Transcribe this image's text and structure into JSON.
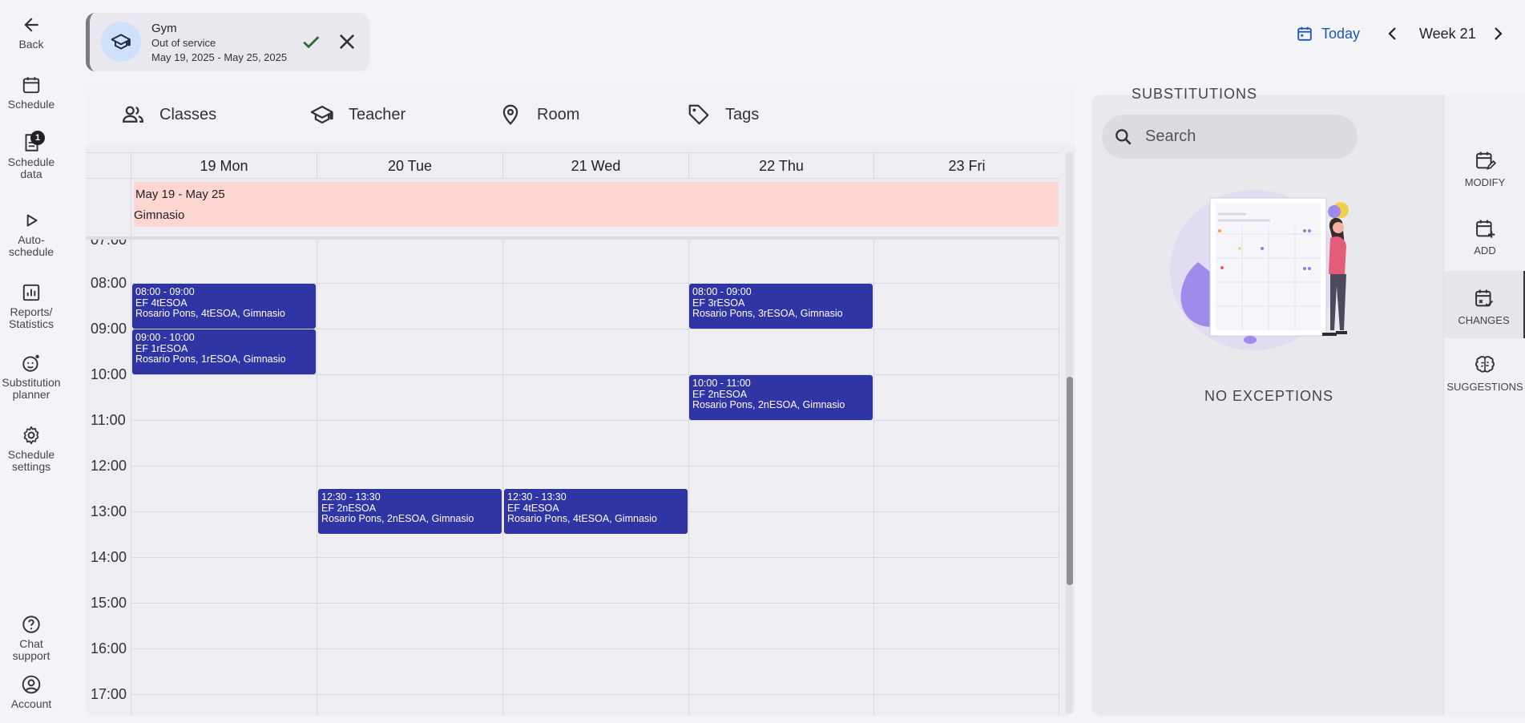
{
  "nav": {
    "back": "Back",
    "schedule": "Schedule",
    "schedule_data": "Schedule\ndata",
    "schedule_data_badge": "1",
    "auto_schedule": "Auto-\nschedule",
    "reports": "Reports/\nStatistics",
    "substitution": "Substitution\nplanner",
    "settings": "Schedule\nsettings",
    "chat": "Chat support",
    "account": "Account"
  },
  "chip": {
    "title": "Gym",
    "status": "Out of service",
    "dates": "May 19, 2025 - May 25, 2025"
  },
  "header": {
    "today": "Today",
    "week": "Week 21"
  },
  "tabs": [
    "Classes",
    "Teacher",
    "Room",
    "Tags"
  ],
  "days": [
    "19 Mon",
    "20 Tue",
    "21 Wed",
    "22 Thu",
    "23 Fri"
  ],
  "allday": {
    "range": "May 19 - May 25",
    "room": "Gimnasio"
  },
  "hours": [
    "07:00",
    "08:00",
    "09:00",
    "10:00",
    "11:00",
    "12:00",
    "13:00",
    "14:00",
    "15:00",
    "16:00",
    "17:00"
  ],
  "events": [
    {
      "time": "08:00 - 09:00",
      "subject": "EF 4tESOA",
      "details": "Rosario Pons, 4tESOA, Gimnasio"
    },
    {
      "time": "09:00 - 10:00",
      "subject": "EF 1rESOA",
      "details": "Rosario Pons, 1rESOA, Gimnasio"
    },
    {
      "time": "08:00 - 09:00",
      "subject": "EF 3rESOA",
      "details": "Rosario Pons, 3rESOA, Gimnasio"
    },
    {
      "time": "10:00 - 11:00",
      "subject": "EF 2nESOA",
      "details": "Rosario Pons, 2nESOA, Gimnasio"
    },
    {
      "time": "12:30 - 13:30",
      "subject": "EF 2nESOA",
      "details": "Rosario Pons, 2nESOA, Gimnasio"
    },
    {
      "time": "12:30 - 13:30",
      "subject": "EF 4tESOA",
      "details": "Rosario Pons, 4tESOA, Gimnasio"
    }
  ],
  "substitutions": {
    "title": "SUBSTITUTIONS",
    "search_placeholder": "Search",
    "empty": "NO EXCEPTIONS"
  },
  "side_tabs": [
    "MODIFY",
    "ADD",
    "CHANGES",
    "SUGGESTIONS"
  ],
  "colors": {
    "event": "#3035a6",
    "allday": "#fed7d3",
    "accent": "#1a56b8"
  }
}
